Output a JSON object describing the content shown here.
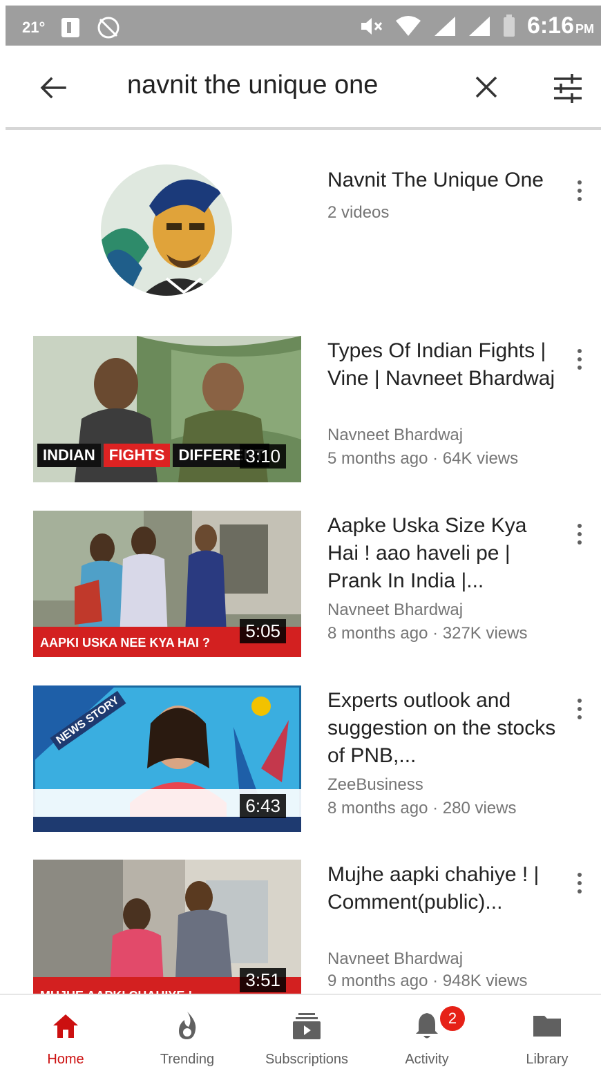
{
  "status_bar": {
    "temperature": "21°",
    "time": "6:16",
    "ampm": "PM"
  },
  "search": {
    "query": "navnit the unique one"
  },
  "channel": {
    "name": "Navnit The Unique One",
    "video_count": "2 videos"
  },
  "videos": [
    {
      "title": "Types Of Indian Fights | Vine | Navneet Bhardwaj",
      "channel": "Navneet Bhardwaj",
      "meta": "5 months ago · 64K views",
      "duration": "3:10",
      "thumb_caption": [
        "INDIAN",
        "FIGHTS",
        "DIFFERENT"
      ]
    },
    {
      "title": "Aapke Uska Size Kya Hai ! aao haveli pe | Prank In India |...",
      "channel": "Navneet Bhardwaj",
      "meta": "8 months ago · 327K views",
      "duration": "5:05",
      "thumb_caption": [
        "AAPKI USKA NEE KYA HAI ?"
      ]
    },
    {
      "title": "Experts outlook and suggestion on the stocks of PNB,...",
      "channel": "ZeeBusiness",
      "meta": "8 months ago · 280 views",
      "duration": "6:43",
      "thumb_caption": [
        "NEWS STORY"
      ]
    },
    {
      "title": "Mujhe aapki chahiye ! | Comment(public)...",
      "channel": "Navneet Bhardwaj",
      "meta": "9 months ago · 948K views",
      "duration": "3:51",
      "thumb_caption": [
        "MUJHE AAPKI CHAHIYE !"
      ]
    }
  ],
  "bottom_nav": {
    "items": [
      {
        "label": "Home",
        "icon": "home-icon",
        "active": true
      },
      {
        "label": "Trending",
        "icon": "flame-icon"
      },
      {
        "label": "Subscriptions",
        "icon": "subscriptions-icon"
      },
      {
        "label": "Activity",
        "icon": "bell-icon",
        "badge": "2"
      },
      {
        "label": "Library",
        "icon": "folder-icon"
      }
    ]
  },
  "colors": {
    "accent": "#cc1010",
    "badge": "#e62117",
    "status_bar": "#9e9e9e"
  }
}
